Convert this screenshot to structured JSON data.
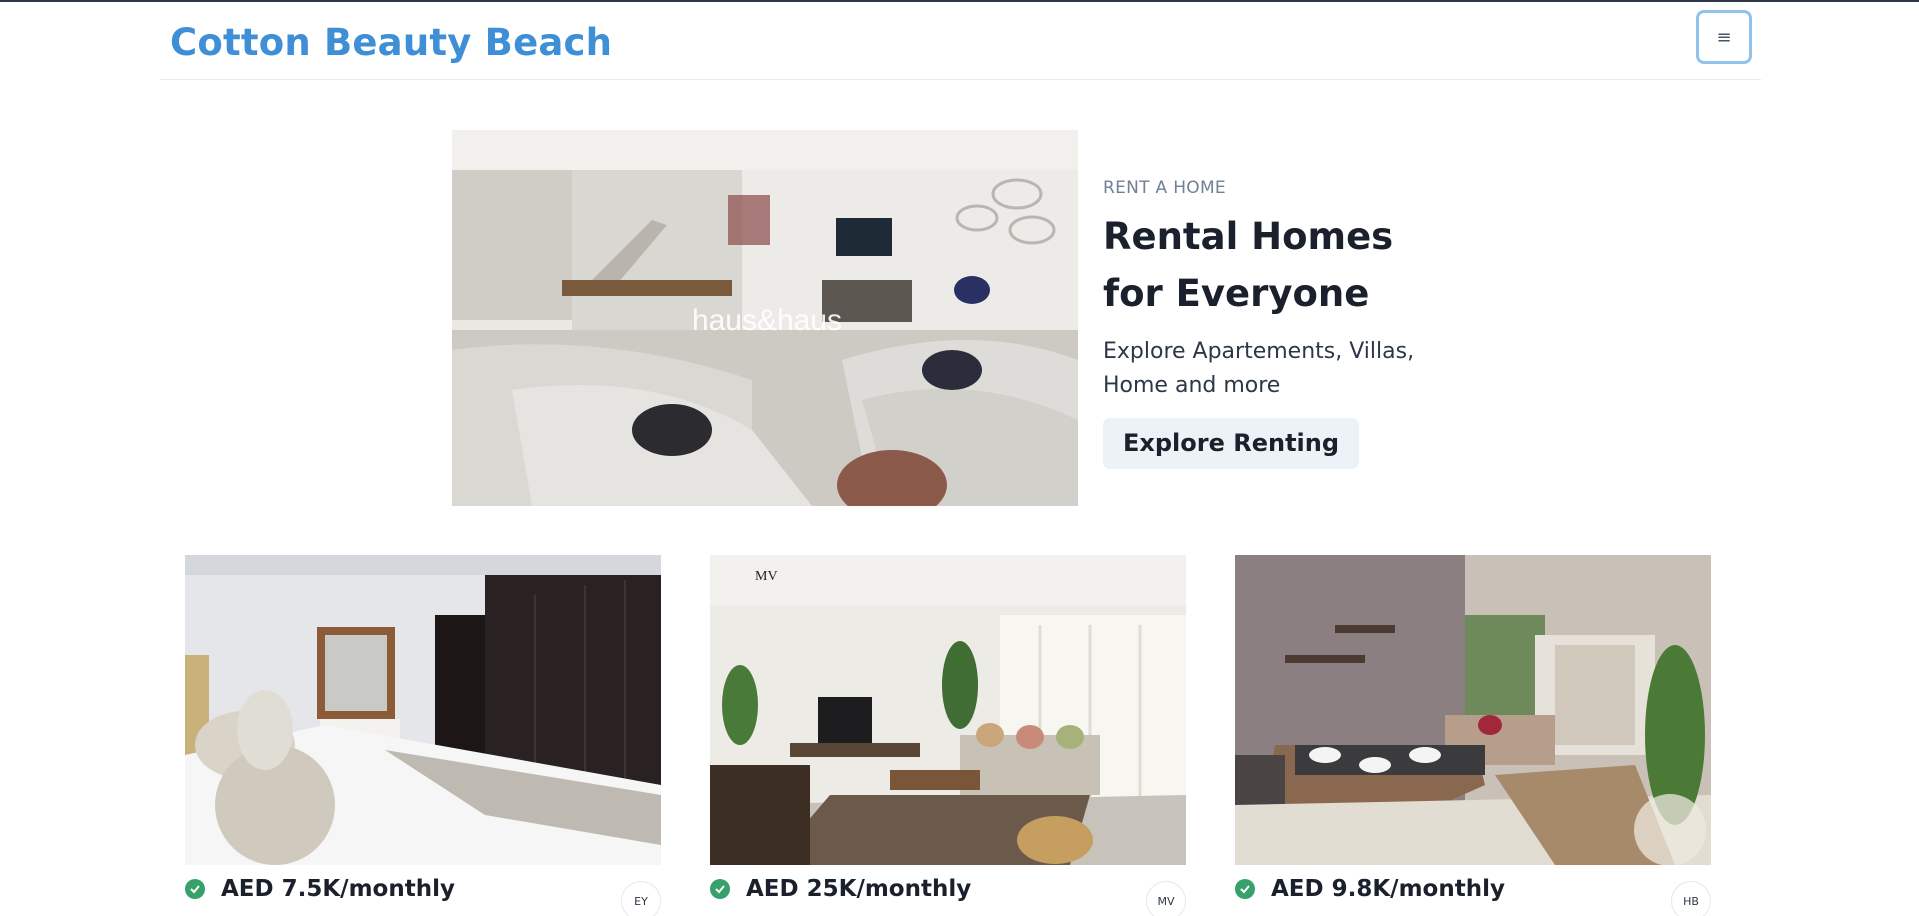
{
  "header": {
    "brand": "Cotton Beauty Beach",
    "menu_icon": "hamburger-icon",
    "menu_glyph": "≡"
  },
  "hero": {
    "eyebrow": "RENT A HOME",
    "title": "Rental Homes for Everyone",
    "subtitle": "Explore Apartements, Villas, Home and more",
    "cta_label": "Explore Renting",
    "image_watermark": "haus&haus"
  },
  "listings": [
    {
      "price": "AED 7.5K/monthly",
      "logo_text": "EY"
    },
    {
      "price": "AED 25K/monthly",
      "logo_text": "MV"
    },
    {
      "price": "AED 9.8K/monthly",
      "logo_text": "HB"
    }
  ],
  "colors": {
    "brand": "#3f8fd6",
    "verified": "#38a169",
    "cta_bg": "#edf2f7"
  }
}
